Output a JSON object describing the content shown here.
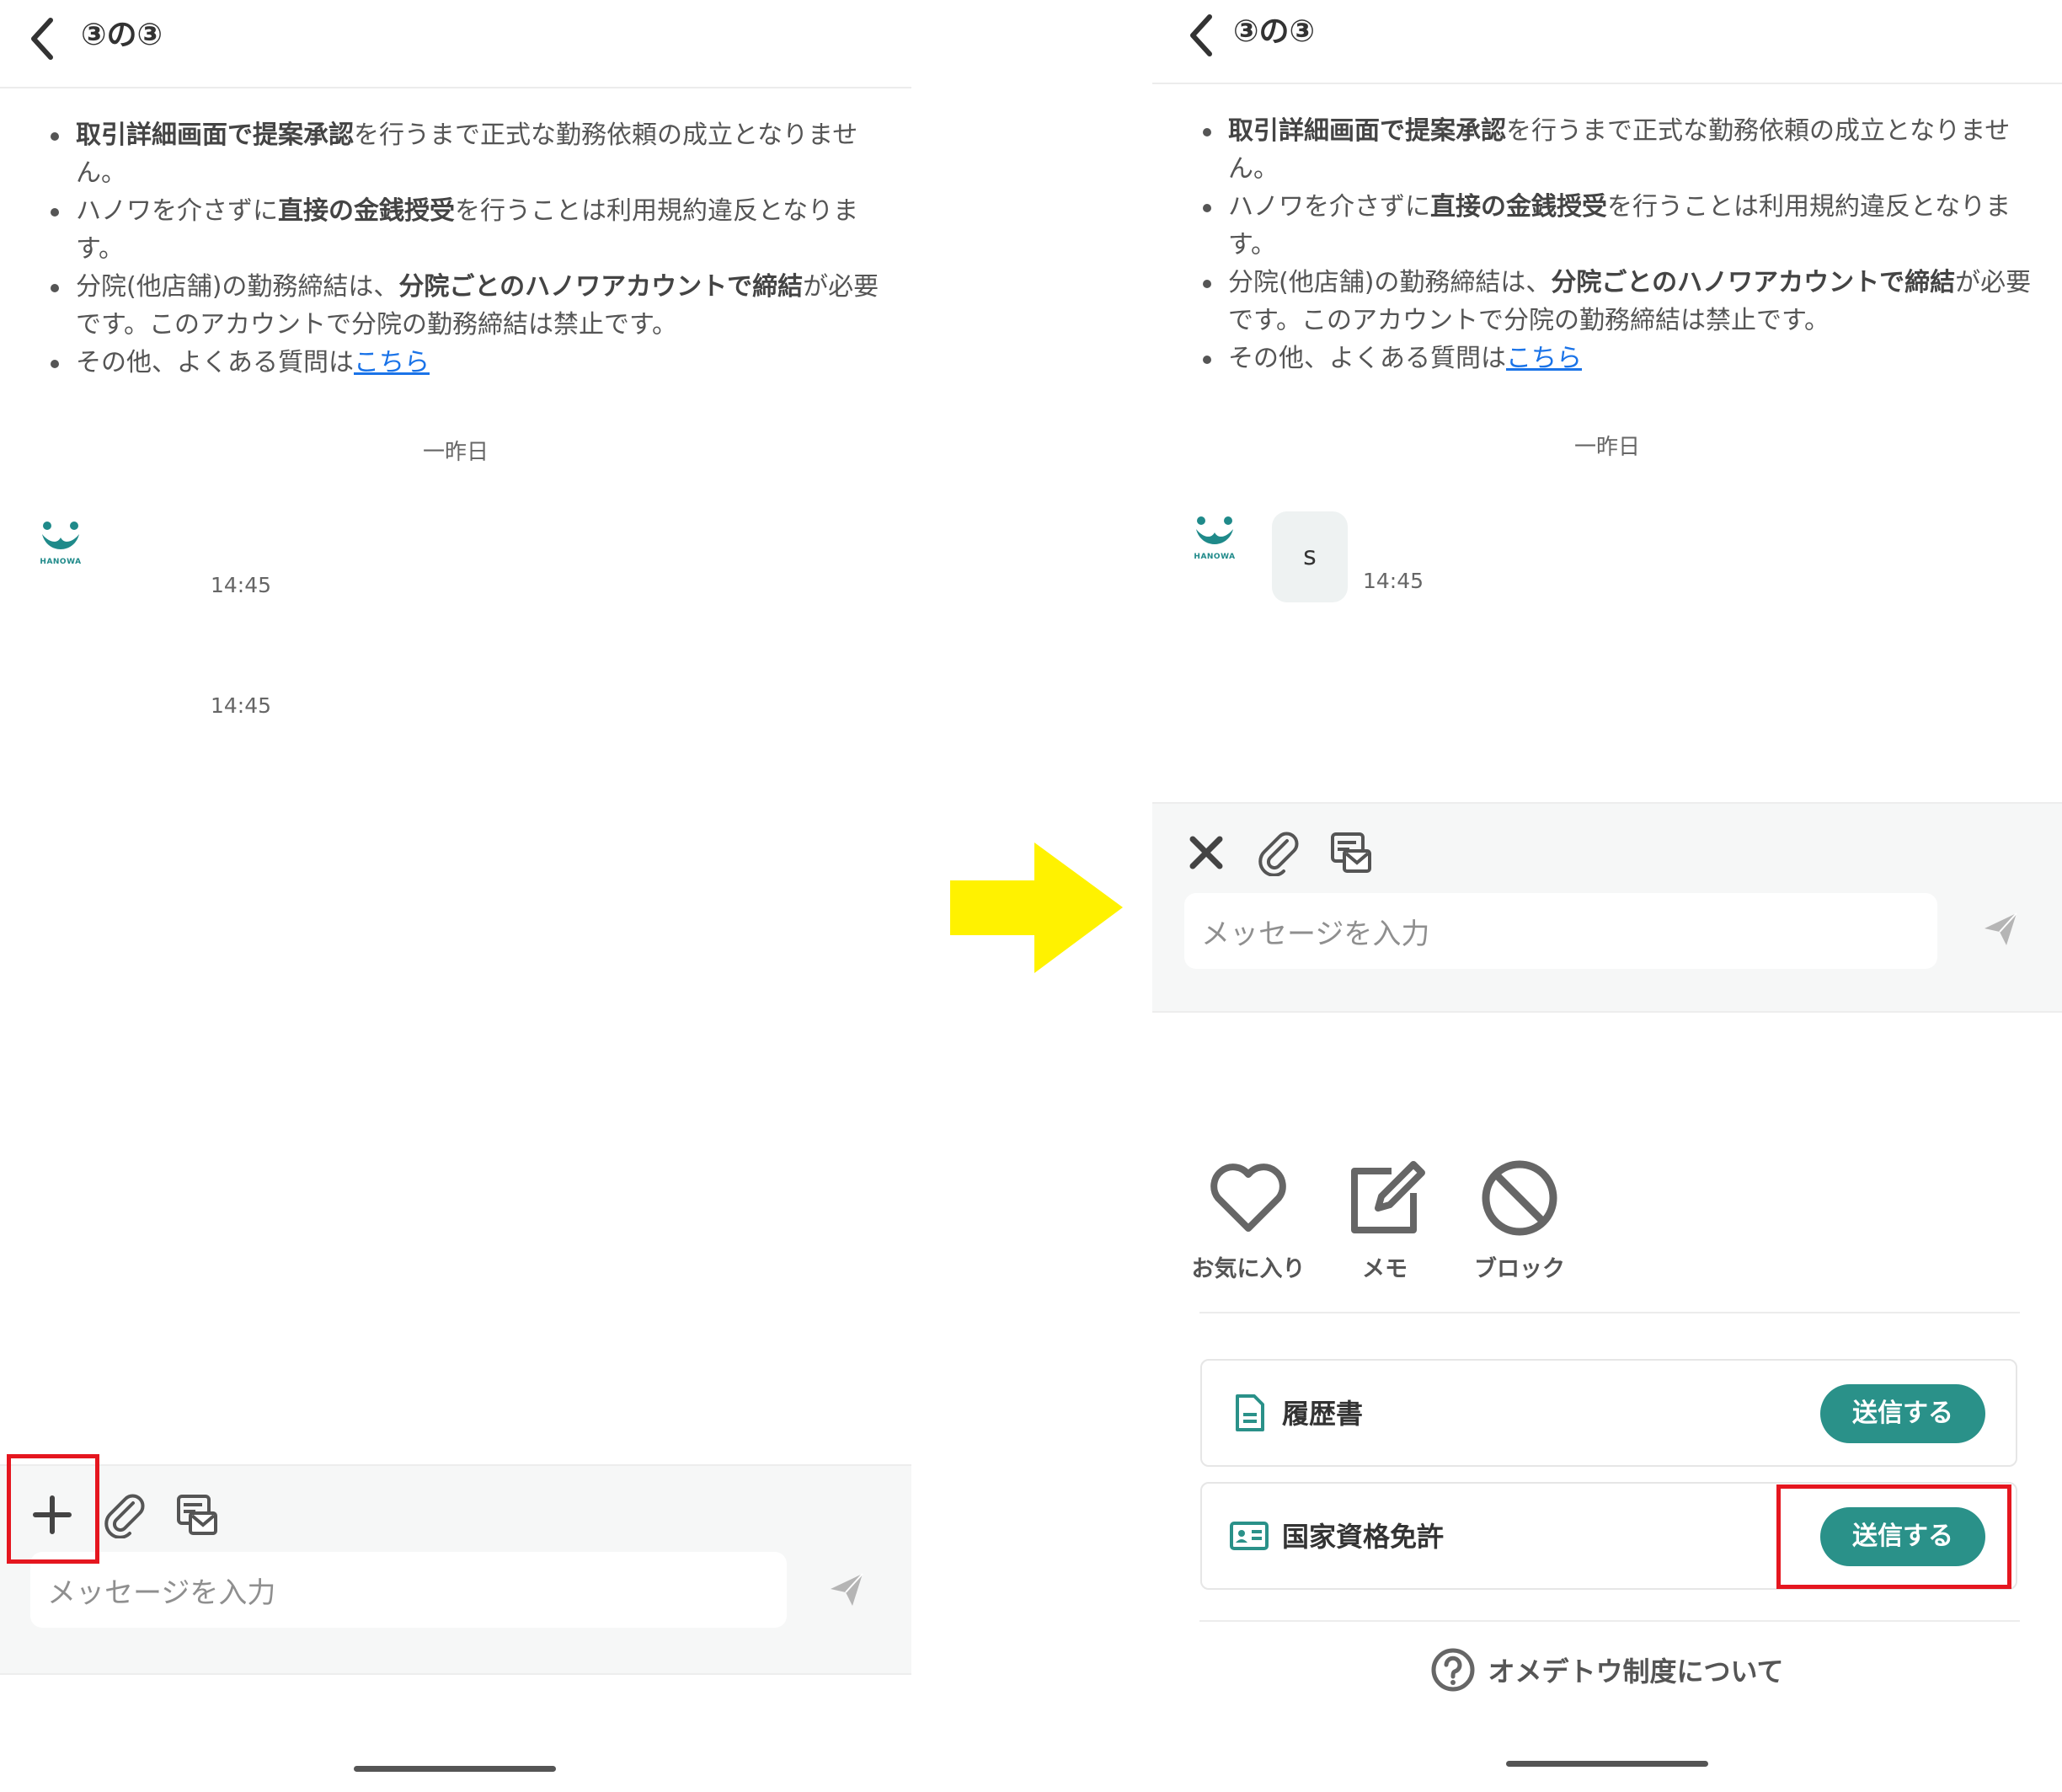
{
  "left": {
    "header": {
      "title": "③の③"
    },
    "notes": [
      {
        "bold1": "取引詳細画面で提案承認",
        "text1": "を行うまで正式な勤務依頼の成立となりません。"
      },
      {
        "text0": "ハノワを介さずに",
        "bold1": "直接の金銭授受",
        "text1": "を行うことは利用規約違反となります。"
      },
      {
        "text0": "分院(他店舗)の勤務締結は、",
        "bold1": "分院ごとのハノワアカウントで締結",
        "text1": "が必要です。このアカウントで分院の勤務締結は禁止です。"
      },
      {
        "text0": "その他、よくある質問は",
        "link": "こちら"
      }
    ],
    "date_separator": "一昨日",
    "logo_text": "HANOWA",
    "messages": [
      {
        "time": "14:45"
      },
      {
        "time": "14:45"
      }
    ],
    "composer": {
      "placeholder": "メッセージを入力"
    }
  },
  "right": {
    "header": {
      "title": "③の③"
    },
    "notes": [
      {
        "bold1": "取引詳細画面で提案承認",
        "text1": "を行うまで正式な勤務依頼の成立となりません。"
      },
      {
        "text0": "ハノワを介さずに",
        "bold1": "直接の金銭授受",
        "text1": "を行うことは利用規約違反となります。"
      },
      {
        "text0": "分院(他店舗)の勤務締結は、",
        "bold1": "分院ごとのハノワアカウントで締結",
        "text1": "が必要です。このアカウントで分院の勤務締結は禁止です。"
      },
      {
        "text0": "その他、よくある質問は",
        "link": "こちら"
      }
    ],
    "date_separator": "一昨日",
    "logo_text": "HANOWA",
    "message": {
      "text": "s",
      "time": "14:45"
    },
    "composer": {
      "placeholder": "メッセージを入力"
    },
    "actions": [
      {
        "label": "お気に入り",
        "icon": "heart-icon"
      },
      {
        "label": "メモ",
        "icon": "edit-icon"
      },
      {
        "label": "ブロック",
        "icon": "block-icon"
      }
    ],
    "documents": [
      {
        "label": "履歴書",
        "icon": "document-icon",
        "button": "送信する"
      },
      {
        "label": "国家資格免許",
        "icon": "id-card-icon",
        "button": "送信する"
      }
    ],
    "help": {
      "label": "オメデトウ制度について",
      "icon": "question-circle-icon"
    }
  },
  "colors": {
    "accent": "#2a9189",
    "highlight": "#e5161f",
    "arrow": "#fff200",
    "link": "#1a73e8"
  }
}
